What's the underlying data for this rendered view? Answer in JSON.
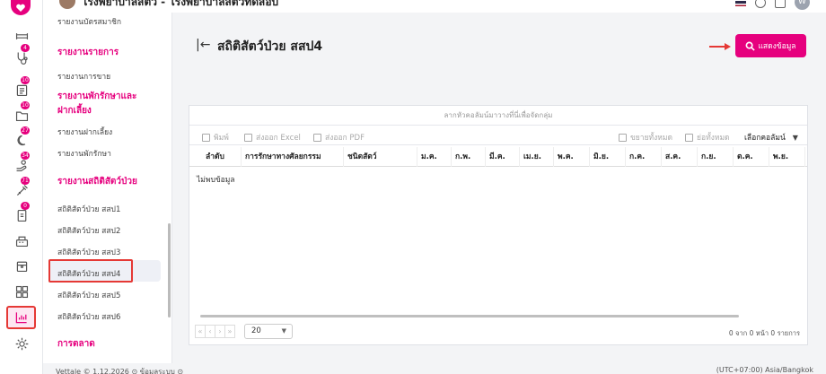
{
  "header": {
    "title": "โรงพยาบาลสัตว์ - โรงพยาบาลสัตว์ทดสอบ",
    "user_initial": "W"
  },
  "rail": {
    "badges": [
      "4",
      "10",
      "10",
      "27",
      "34",
      "71",
      "0"
    ]
  },
  "sidebar": {
    "top_item": "รายงานบัตรสมาชิก",
    "sections": [
      {
        "heading": "รายงานรายการ",
        "items": [
          "รายงานการขาย"
        ]
      },
      {
        "heading": "รายงานพักรักษาและฝากเลี้ยง",
        "items": [
          "รายงานฝากเลี้ยง",
          "รายงานพักรักษา"
        ]
      },
      {
        "heading": "รายงานสถิติสัตว์ป่วย",
        "items": [
          "สถิติสัตว์ป่วย สสป1",
          "สถิติสัตว์ป่วย สสป2",
          "สถิติสัตว์ป่วย สสป3",
          "สถิติสัตว์ป่วย สสป4",
          "สถิติสัตว์ป่วย สสป5",
          "สถิติสัตว์ป่วย สสป6"
        ]
      },
      {
        "heading": "การตลาด",
        "items": []
      }
    ],
    "active_item": "สถิติสัตว์ป่วย สสป4"
  },
  "page": {
    "title": "สถิติสัตว์ป่วย สสป4",
    "show_button": "แสดงข้อมูล"
  },
  "table": {
    "group_hint": "ลากหัวคอลัมน์มาวางที่นี่เพื่อจัดกลุ่ม",
    "toolbar": {
      "print": "พิมพ์",
      "export_excel": "ส่งออก Excel",
      "export_pdf": "ส่งออก PDF",
      "expand_all": "ขยายทั้งหมด",
      "collapse_all": "ย่อทั้งหมด",
      "choose_columns": "เลือกคอลัมน์"
    },
    "columns": [
      "ลำดับ",
      "การรักษาทางศัลยกรรม",
      "ชนิดสัตว์",
      "ม.ค.",
      "ก.พ.",
      "มี.ค.",
      "เม.ย.",
      "พ.ค.",
      "มิ.ย.",
      "ก.ค.",
      "ส.ค.",
      "ก.ย.",
      "ต.ค.",
      "พ.ย."
    ],
    "empty_text": "ไม่พบข้อมูล",
    "page_size": "20",
    "pager_info": "0 จาก 0 หน้า 0 รายการ"
  },
  "footer": {
    "left": "Vettale © 1.12.2026   ⊙ ข้อมูลระบบ ⊙",
    "right": "(UTC+07:00) Asia/Bangkok"
  },
  "colors": {
    "accent": "#e6007e",
    "highlight_outline": "#e53935"
  }
}
